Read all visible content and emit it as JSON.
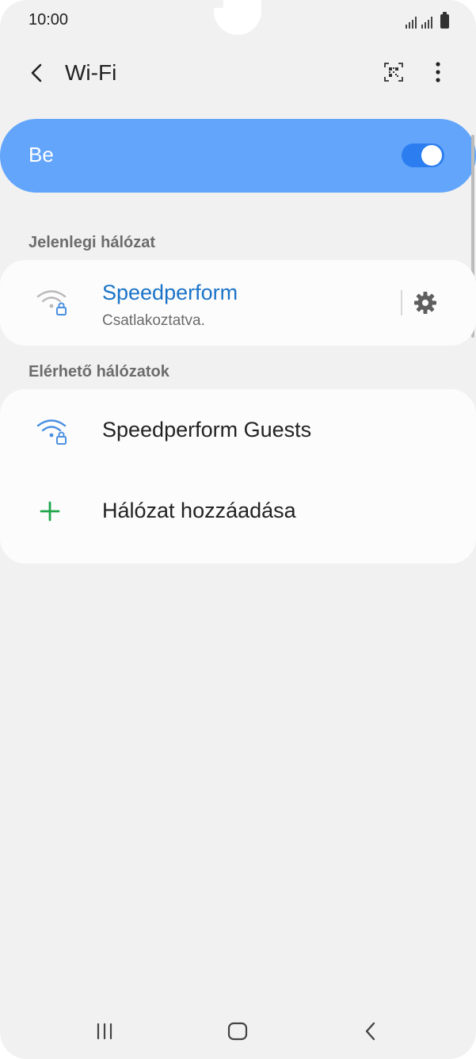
{
  "status_bar": {
    "time": "10:00"
  },
  "header": {
    "title": "Wi-Fi"
  },
  "master": {
    "label": "Be",
    "enabled": true,
    "color": "#62a5fb"
  },
  "current_network": {
    "section_label": "Jelenlegi hálózat",
    "name": "Speedperform",
    "status": "Csatlakoztatva.",
    "name_color": "#1a73c7"
  },
  "available": {
    "section_label": "Elérhető hálózatok",
    "networks": [
      {
        "name": "Speedperform Guests",
        "icon": "wifi-lock-icon"
      }
    ],
    "add_label": "Hálózat hozzáadása"
  },
  "icons": {
    "back": "back-arrow-icon",
    "qr": "qr-scan-icon",
    "more": "more-vertical-icon",
    "settings": "gear-icon",
    "add": "plus-icon"
  }
}
